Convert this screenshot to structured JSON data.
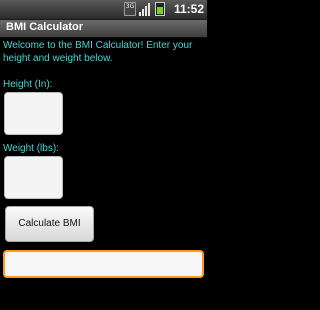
{
  "status_bar": {
    "network_label": "3G",
    "clock": "11:52",
    "signal_icon": "signal-icon",
    "battery_icon": "battery-icon",
    "battery_color": "#7bd12b"
  },
  "app": {
    "title": "BMI Calculator"
  },
  "content": {
    "welcome_text": "Welcome to the BMI Calculator! Enter your height and weight below.",
    "height_label": "Height (In):",
    "height_value": "",
    "weight_label": "Weight (lbs):",
    "weight_value": "",
    "calculate_label": "Calculate BMI",
    "result_value": ""
  },
  "colors": {
    "label_color": "#3fd6d6",
    "focus_border": "#ff9a1a"
  }
}
